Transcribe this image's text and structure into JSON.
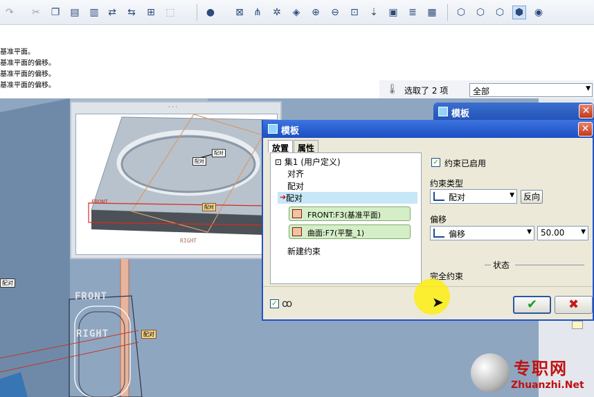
{
  "toolbar": {
    "icons": [
      "redo-icon",
      "cut-icon",
      "copy-icon",
      "paste-icon",
      "paste-special-icon",
      "regenerate-icon",
      "regenerate-manager-icon",
      "find-icon",
      "select-box-icon",
      "shading-icon",
      "refit-icon",
      "datum-display-icon",
      "spin-center-icon",
      "orient-icon",
      "zoom-in-icon",
      "zoom-out-icon",
      "zoom-fit-icon",
      "view-manager-icon",
      "layers-icon",
      "model-tree-icon",
      "wireframe-icon",
      "hidden-line-icon",
      "no-hidden-icon",
      "shaded-icon",
      "model-player-icon"
    ]
  },
  "messages": {
    "lines": [
      "选取基准平面。",
      "选取基准平面的偏移。",
      "选取基准平面的偏移。",
      "选取基准平面的偏移。"
    ],
    "line1": "基准平面。",
    "line2": "基准平面的偏移。",
    "line3": "基准平面的偏移。",
    "line4": "基准平面的偏移。"
  },
  "selection": {
    "status": "选取了 2 项",
    "filter": "全部"
  },
  "bg_dialog": {
    "title": "模板"
  },
  "dialog": {
    "title": "模板",
    "tabs": {
      "placement": "放置",
      "properties": "属性"
    },
    "tree": {
      "set": "⊡ 集1 (用户定义)",
      "align": "对齐",
      "mate1": "配对",
      "mate2": "配对",
      "ref_front": "FRONT:F3(基准平面)",
      "ref_surface": "曲面:F7(平整_1)",
      "new_constraint": "新建约束"
    },
    "constraint_enabled": "约束已启用",
    "constraint_type_label": "约束类型",
    "constraint_type_value": "配对",
    "flip": "反向",
    "offset_label": "偏移",
    "offset_type": "偏移",
    "offset_value": "50.00",
    "status_heading": "状态",
    "status_value": "完全约束",
    "ok_symbol": "✔",
    "cancel_symbol": "✖",
    "preview_symbol": "✓"
  },
  "model": {
    "label_front": "FRONT",
    "label_right": "RIGHT",
    "tag_mate": "配对"
  },
  "watermark": {
    "cn": "专职网",
    "en": "Zhuanzhi.Net"
  },
  "colors": {
    "titlebar": "#1c4fc2",
    "model_edge": "#c0362c",
    "cursor_highlight": "#ffee00",
    "watermark": "#c01010"
  }
}
